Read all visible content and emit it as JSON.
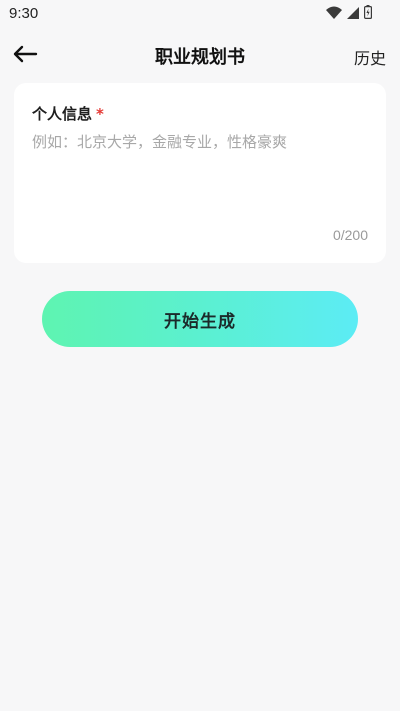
{
  "status_bar": {
    "time": "9:30",
    "icons": [
      "wifi-icon",
      "cell-signal-icon",
      "battery-icon"
    ]
  },
  "nav": {
    "back_icon": "arrow-left-icon",
    "title": "职业规划书",
    "history_label": "历史"
  },
  "form": {
    "label": "个人信息",
    "required_mark": "*",
    "input_value": "",
    "input_placeholder": "例如：北京大学，金融专业，性格豪爽",
    "counter": "0/200"
  },
  "actions": {
    "generate_label": "开始生成"
  },
  "colors": {
    "page_background": "#f7f7f8",
    "card_background": "#ffffff",
    "required": "#e53935",
    "button_gradient_start": "#5ef4b1",
    "button_gradient_end": "#5cecf5"
  }
}
